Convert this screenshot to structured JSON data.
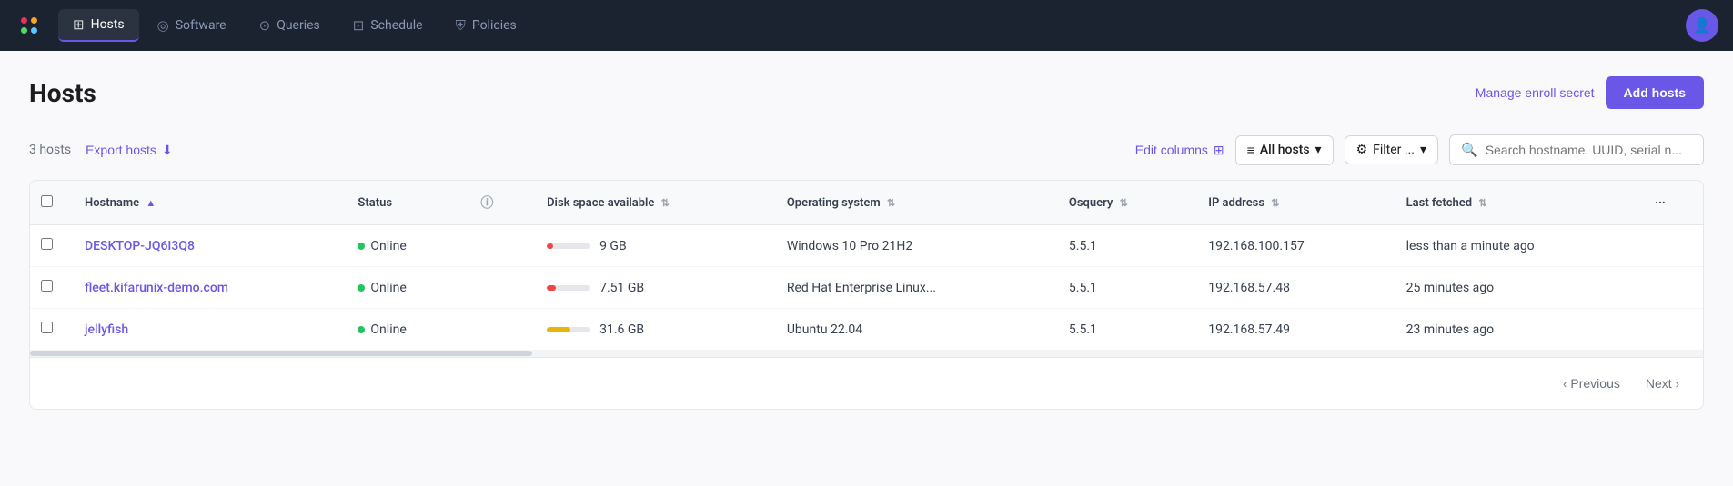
{
  "nav": {
    "items": [
      {
        "id": "hosts",
        "label": "Hosts",
        "icon": "⊞",
        "active": true
      },
      {
        "id": "software",
        "label": "Software",
        "icon": "◎",
        "active": false
      },
      {
        "id": "queries",
        "label": "Queries",
        "icon": "⊙",
        "active": false
      },
      {
        "id": "schedule",
        "label": "Schedule",
        "icon": "⊡",
        "active": false
      },
      {
        "id": "policies",
        "label": "Policies",
        "icon": "⛨",
        "active": false
      }
    ]
  },
  "page": {
    "title": "Hosts",
    "manage_enroll_label": "Manage enroll secret",
    "add_hosts_label": "Add hosts"
  },
  "toolbar": {
    "hosts_count": "3 hosts",
    "export_hosts_label": "Export hosts",
    "edit_columns_label": "Edit columns",
    "all_hosts_label": "All hosts",
    "filter_label": "Filter ...",
    "search_placeholder": "Search hostname, UUID, serial n..."
  },
  "table": {
    "columns": [
      {
        "id": "hostname",
        "label": "Hostname",
        "sort": "asc"
      },
      {
        "id": "status",
        "label": "Status",
        "sort": null
      },
      {
        "id": "info",
        "label": "",
        "sort": null
      },
      {
        "id": "disk_space",
        "label": "Disk space available",
        "sort": "default"
      },
      {
        "id": "os",
        "label": "Operating system",
        "sort": "default"
      },
      {
        "id": "osquery",
        "label": "Osquery",
        "sort": "default"
      },
      {
        "id": "ip",
        "label": "IP address",
        "sort": "default"
      },
      {
        "id": "last_fetched",
        "label": "Last fetched",
        "sort": "default"
      }
    ],
    "rows": [
      {
        "hostname": "DESKTOP-JQ6I3Q8",
        "status": "Online",
        "disk_space": "9 GB",
        "disk_pct": 15,
        "disk_color": "red",
        "os": "Windows 10 Pro 21H2",
        "osquery": "5.5.1",
        "ip": "192.168.100.157",
        "last_fetched": "less than a minute ago"
      },
      {
        "hostname": "fleet.kifarunix-demo.com",
        "status": "Online",
        "disk_space": "7.51 GB",
        "disk_pct": 20,
        "disk_color": "red",
        "os": "Red Hat Enterprise Linux...",
        "osquery": "5.5.1",
        "ip": "192.168.57.48",
        "last_fetched": "25 minutes ago"
      },
      {
        "hostname": "jellyfish",
        "status": "Online",
        "disk_space": "31.6 GB",
        "disk_pct": 55,
        "disk_color": "yellow",
        "os": "Ubuntu 22.04",
        "osquery": "5.5.1",
        "ip": "192.168.57.49",
        "last_fetched": "23 minutes ago"
      }
    ]
  },
  "pagination": {
    "previous_label": "Previous",
    "next_label": "Next"
  }
}
